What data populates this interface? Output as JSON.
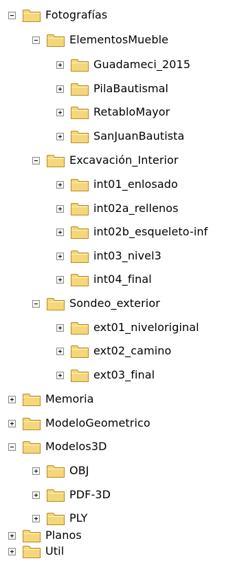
{
  "tree": [
    {
      "label": "Fotografías",
      "expanded": true,
      "icon": "folder-icon"
    },
    {
      "label": "ElementosMueble",
      "expanded": true,
      "icon": "folder-icon"
    },
    {
      "label": "Guadameci_2015",
      "expanded": false,
      "icon": "folder-icon"
    },
    {
      "label": "PilaBautismal",
      "expanded": false,
      "icon": "folder-icon"
    },
    {
      "label": "RetabloMayor",
      "expanded": false,
      "icon": "folder-icon"
    },
    {
      "label": "SanJuanBautista",
      "expanded": false,
      "icon": "folder-icon"
    },
    {
      "label": "Excavación_Interior",
      "expanded": true,
      "icon": "folder-icon"
    },
    {
      "label": "int01_enlosado",
      "expanded": false,
      "icon": "folder-icon"
    },
    {
      "label": "int02a_rellenos",
      "expanded": false,
      "icon": "folder-icon"
    },
    {
      "label": "int02b_esqueleto-inf",
      "expanded": false,
      "icon": "folder-icon"
    },
    {
      "label": "int03_nivel3",
      "expanded": false,
      "icon": "folder-icon"
    },
    {
      "label": "int04_final",
      "expanded": false,
      "icon": "folder-icon"
    },
    {
      "label": "Sondeo_exterior",
      "expanded": true,
      "icon": "folder-icon"
    },
    {
      "label": "ext01_niveloriginal",
      "expanded": false,
      "icon": "folder-icon"
    },
    {
      "label": "ext02_camino",
      "expanded": false,
      "icon": "folder-icon"
    },
    {
      "label": "ext03_final",
      "expanded": false,
      "icon": "folder-icon"
    },
    {
      "label": "Memoria",
      "expanded": false,
      "icon": "folder-icon"
    },
    {
      "label": "ModeloGeometrico",
      "expanded": false,
      "icon": "folder-icon"
    },
    {
      "label": "Modelos3D",
      "expanded": true,
      "icon": "folder-icon"
    },
    {
      "label": "OBJ",
      "expanded": false,
      "icon": "folder-icon"
    },
    {
      "label": "PDF-3D",
      "expanded": false,
      "icon": "folder-icon"
    },
    {
      "label": "PLY",
      "expanded": false,
      "icon": "folder-icon"
    },
    {
      "label": "Planos",
      "expanded": false,
      "icon": "folder-icon"
    },
    {
      "label": "Util",
      "expanded": false,
      "icon": "folder-icon"
    }
  ],
  "colors": {
    "folder_fill": "#f4d77a",
    "folder_stroke": "#b38a22",
    "expander_border": "#8a8a8a"
  }
}
